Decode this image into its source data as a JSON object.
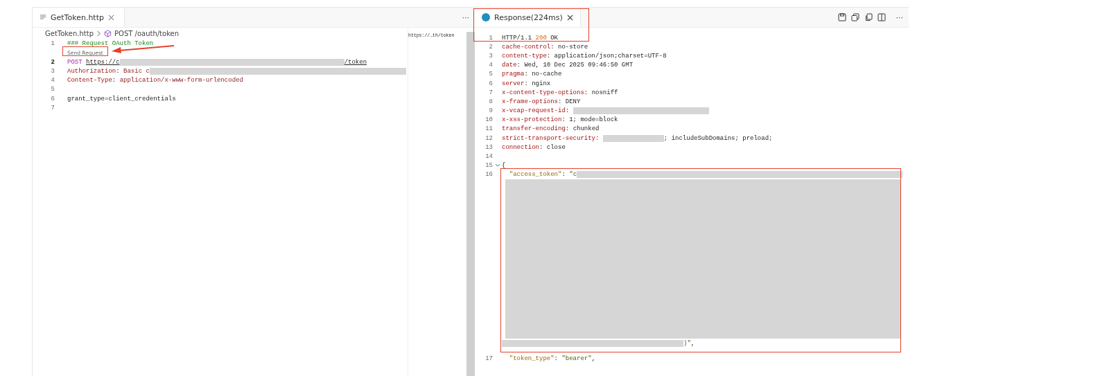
{
  "left_editor": {
    "tab": {
      "label": "GetToken.http",
      "selected": true
    },
    "more": "···",
    "breadcrumb": {
      "file": "GetToken.http",
      "request": "POST /oauth/token"
    },
    "lines": [
      {
        "kind": "code",
        "number": "1",
        "current": false,
        "tokens": [
          {
            "kind": "comment",
            "text": "### Request OAuth Token"
          }
        ]
      },
      {
        "kind": "codelens",
        "text": "Send Request"
      },
      {
        "kind": "code",
        "number": "2",
        "current": true,
        "tokens": [
          {
            "kind": "method",
            "text": "POST "
          },
          {
            "kind": "url",
            "text": "https://c"
          },
          {
            "kind": "redacted"
          },
          {
            "kind": "url",
            "text": "/token"
          }
        ]
      },
      {
        "kind": "code",
        "number": "3",
        "current": false,
        "tokens": [
          {
            "kind": "header",
            "text": "Authorization"
          },
          {
            "kind": "plain",
            "text": ": "
          },
          {
            "kind": "value",
            "text": "Basic c"
          },
          {
            "kind": "redacted"
          }
        ]
      },
      {
        "kind": "code",
        "number": "4",
        "current": false,
        "tokens": [
          {
            "kind": "header",
            "text": "Content-Type"
          },
          {
            "kind": "plain",
            "text": ": "
          },
          {
            "kind": "value",
            "text": "application/x-www-form-urlencoded"
          }
        ]
      },
      {
        "kind": "code",
        "number": "5",
        "current": false
      },
      {
        "kind": "code",
        "number": "6",
        "current": false,
        "tokens": [
          {
            "kind": "plain",
            "text": "grant_type=client_credentials"
          }
        ]
      },
      {
        "kind": "code",
        "number": "7",
        "current": false
      }
    ],
    "minimap_text": "https://…th/token"
  },
  "right_editor": {
    "tab": {
      "label": "Response(224ms)",
      "selected": true
    },
    "more": "···",
    "lines": [
      {
        "kind": "code",
        "number": "1",
        "tokens": [
          {
            "kind": "plain",
            "text": "HTTP/1.1 "
          },
          {
            "kind": "number",
            "text": "200"
          },
          {
            "kind": "plain",
            "text": " OK"
          }
        ]
      },
      {
        "kind": "code",
        "number": "2",
        "tokens": [
          {
            "kind": "header",
            "text": "cache-control"
          },
          {
            "kind": "plain",
            "text": ": no-store"
          }
        ]
      },
      {
        "kind": "code",
        "number": "3",
        "tokens": [
          {
            "kind": "header",
            "text": "content-type"
          },
          {
            "kind": "plain",
            "text": ": application/json;charset=UTF-8"
          }
        ]
      },
      {
        "kind": "code",
        "number": "4",
        "tokens": [
          {
            "kind": "header",
            "text": "date"
          },
          {
            "kind": "plain",
            "text": ": Wed, 10 Dec 2025 09:46:50 GMT"
          }
        ]
      },
      {
        "kind": "code",
        "number": "5",
        "tokens": [
          {
            "kind": "header",
            "text": "pragma"
          },
          {
            "kind": "plain",
            "text": ": no-cache"
          }
        ]
      },
      {
        "kind": "code",
        "number": "6",
        "tokens": [
          {
            "kind": "header",
            "text": "server"
          },
          {
            "kind": "plain",
            "text": ": nginx"
          }
        ]
      },
      {
        "kind": "code",
        "number": "7",
        "tokens": [
          {
            "kind": "header",
            "text": "x-content-type-options"
          },
          {
            "kind": "plain",
            "text": ": nosniff"
          }
        ]
      },
      {
        "kind": "code",
        "number": "8",
        "tokens": [
          {
            "kind": "header",
            "text": "x-frame-options"
          },
          {
            "kind": "plain",
            "text": ": DENY"
          }
        ]
      },
      {
        "kind": "code",
        "number": "9",
        "tokens": [
          {
            "kind": "header",
            "text": "x-vcap-request-id"
          },
          {
            "kind": "plain",
            "text": ": "
          },
          {
            "kind": "redacted"
          }
        ]
      },
      {
        "kind": "code",
        "number": "10",
        "tokens": [
          {
            "kind": "header",
            "text": "x-xss-protection"
          },
          {
            "kind": "plain",
            "text": ": 1; mode=block"
          }
        ]
      },
      {
        "kind": "code",
        "number": "11",
        "tokens": [
          {
            "kind": "header",
            "text": "transfer-encoding"
          },
          {
            "kind": "plain",
            "text": ": chunked"
          }
        ]
      },
      {
        "kind": "code",
        "number": "12",
        "tokens": [
          {
            "kind": "header",
            "text": "strict-transport-security"
          },
          {
            "kind": "plain",
            "text": ": "
          },
          {
            "kind": "redacted"
          },
          {
            "kind": "plain",
            "text": "; includeSubDomains; preload;"
          }
        ]
      },
      {
        "kind": "code",
        "number": "13",
        "tokens": [
          {
            "kind": "header",
            "text": "connection"
          },
          {
            "kind": "plain",
            "text": ": close"
          }
        ]
      },
      {
        "kind": "code",
        "number": "14"
      },
      {
        "kind": "code",
        "number": "15",
        "foldable": true,
        "tokens": [
          {
            "kind": "plain",
            "text": "{"
          }
        ]
      },
      {
        "kind": "code",
        "number": "16",
        "tokens": [
          {
            "kind": "key",
            "text": "\"access_token\""
          },
          {
            "kind": "plain",
            "text": ": "
          },
          {
            "kind": "string",
            "text": "\"c"
          },
          {
            "kind": "redacted"
          }
        ]
      },
      {
        "kind": "block"
      },
      {
        "kind": "code",
        "tokens": [
          {
            "kind": "redacted"
          },
          {
            "kind": "string",
            "text": ")\""
          },
          {
            "kind": "plain",
            "text": ","
          }
        ]
      },
      {
        "kind": "code",
        "number": "17",
        "tokens": [
          {
            "kind": "key",
            "text": "\"token_type\""
          },
          {
            "kind": "plain",
            "text": ": "
          },
          {
            "kind": "string",
            "text": "\"bearer\""
          },
          {
            "kind": "plain",
            "text": ","
          }
        ]
      }
    ]
  }
}
